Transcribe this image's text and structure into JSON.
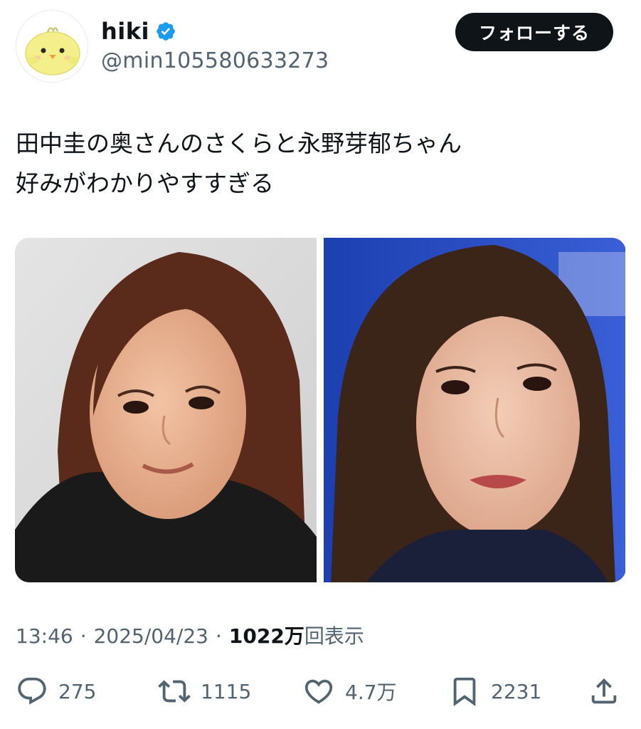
{
  "author": {
    "display_name": "hiki",
    "handle": "@min105580633273",
    "verified": true,
    "avatar_icon": "chick-icon"
  },
  "follow_button": {
    "label": "フォローする"
  },
  "tweet": {
    "lines": [
      "田中圭の奥さんのさくらと永野芽郁ちゃん",
      "好みがわかりやすすぎる"
    ]
  },
  "media": [
    {
      "name": "photo-left"
    },
    {
      "name": "photo-right"
    }
  ],
  "meta": {
    "time": "13:46",
    "separator": "·",
    "date": "2025/04/23",
    "views_count": "1022万",
    "views_label": "回表示"
  },
  "actions": {
    "reply": {
      "icon": "reply-icon",
      "count": "275"
    },
    "retweet": {
      "icon": "retweet-icon",
      "count": "1115"
    },
    "like": {
      "icon": "heart-icon",
      "count": "4.7万"
    },
    "bookmark": {
      "icon": "bookmark-icon",
      "count": "2231"
    },
    "share": {
      "icon": "share-icon"
    }
  },
  "colors": {
    "text_primary": "#0f1419",
    "text_secondary": "#536471",
    "verified_blue": "#1d9bf0",
    "follow_bg": "#0f1419"
  }
}
